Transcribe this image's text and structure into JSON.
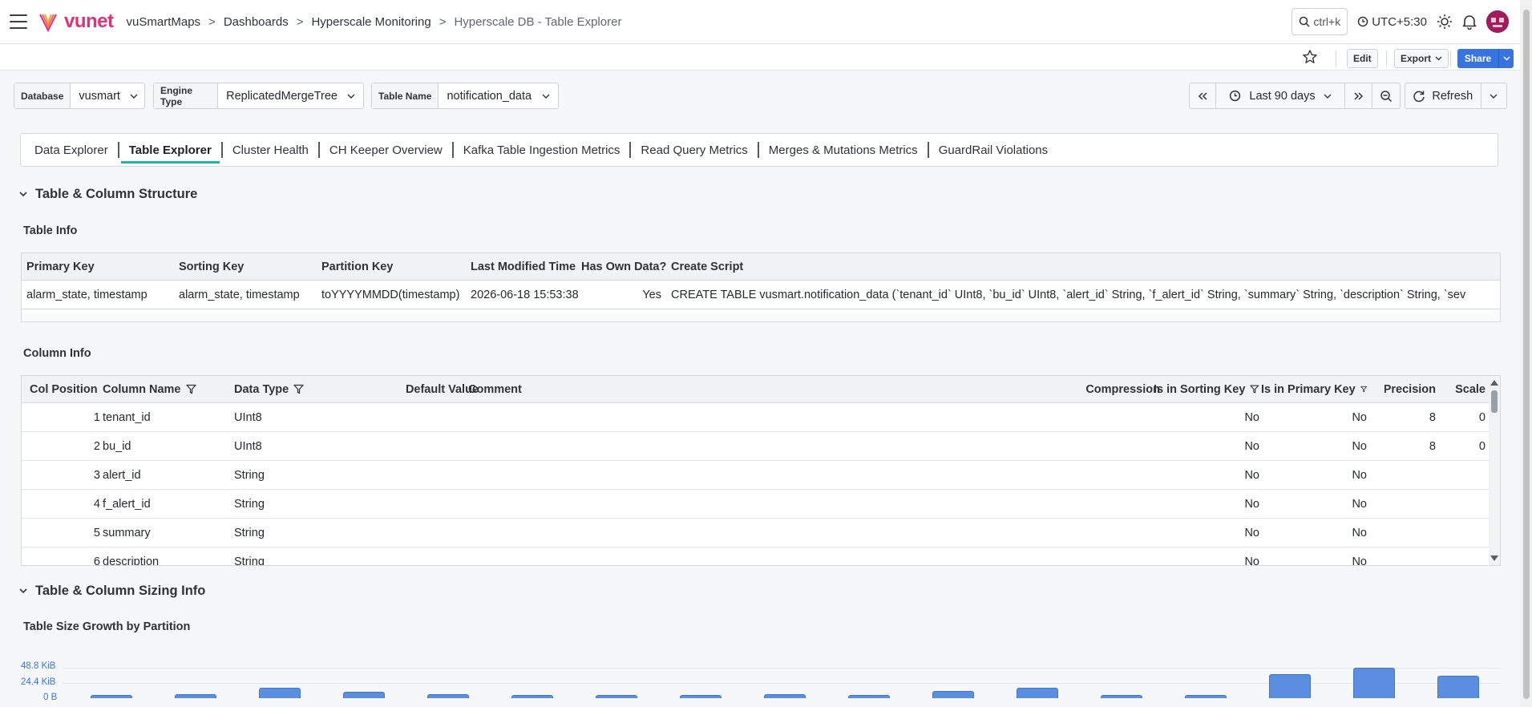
{
  "topbar": {
    "logo_text": "vunet",
    "breadcrumbs": [
      "vuSmartMaps",
      "Dashboards",
      "Hyperscale Monitoring",
      "Hyperscale DB - Table Explorer"
    ],
    "search_shortcut": "ctrl+k",
    "timezone": "UTC+5:30"
  },
  "actions": {
    "edit": "Edit",
    "export": "Export",
    "share": "Share"
  },
  "variables": [
    {
      "label": "Database",
      "value": "vusmart"
    },
    {
      "label": "Engine Type",
      "value": "ReplicatedMergeTree"
    },
    {
      "label": "Table Name",
      "value": "notification_data"
    }
  ],
  "time": {
    "range": "Last 90 days",
    "refresh": "Refresh"
  },
  "tabs": [
    "Data Explorer",
    "Table Explorer",
    "Cluster Health",
    "CH Keeper Overview",
    "Kafka Table Ingestion Metrics",
    "Read Query Metrics",
    "Merges & Mutations Metrics",
    "GuardRail Violations"
  ],
  "active_tab": "Table Explorer",
  "section1": {
    "title": "Table & Column Structure"
  },
  "table_info": {
    "title": "Table Info",
    "columns": [
      "Primary Key",
      "Sorting Key",
      "Partition Key",
      "Last Modified Time",
      "Has Own Data?",
      "Create Script"
    ],
    "row": [
      "alarm_state, timestamp",
      "alarm_state, timestamp",
      "toYYYYMMDD(timestamp)",
      "2026-06-18 15:53:38",
      "Yes",
      "CREATE TABLE vusmart.notification_data (`tenant_id` UInt8, `bu_id` UInt8, `alert_id` String, `f_alert_id` String, `summary` String, `description` String, `sev"
    ]
  },
  "column_info": {
    "title": "Column Info",
    "columns": [
      "Col Position",
      "Column Name",
      "Data Type",
      "Default Value",
      "Comment",
      "Compression",
      "Is in Sorting Key",
      "Is in Primary Key",
      "Precision",
      "Scale"
    ],
    "rows": [
      [
        "1",
        "tenant_id",
        "UInt8",
        "",
        "",
        "",
        "No",
        "No",
        "8",
        "0"
      ],
      [
        "2",
        "bu_id",
        "UInt8",
        "",
        "",
        "",
        "No",
        "No",
        "8",
        "0"
      ],
      [
        "3",
        "alert_id",
        "String",
        "",
        "",
        "",
        "No",
        "No",
        "",
        ""
      ],
      [
        "4",
        "f_alert_id",
        "String",
        "",
        "",
        "",
        "No",
        "No",
        "",
        ""
      ],
      [
        "5",
        "summary",
        "String",
        "",
        "",
        "",
        "No",
        "No",
        "",
        ""
      ],
      [
        "6",
        "description",
        "String",
        "",
        "",
        "",
        "No",
        "No",
        "",
        ""
      ]
    ]
  },
  "section2": {
    "title": "Table & Column Sizing Info"
  },
  "chart_title": "Table Size Growth by Partition",
  "chart_data": {
    "type": "bar",
    "title": "Table Size Growth by Partition",
    "y_ticks": [
      "48.8 KiB",
      "24.4 KiB",
      "0 B"
    ],
    "ylim": [
      0,
      48.8
    ],
    "y_unit": "KiB",
    "values": [
      4,
      7,
      17,
      10,
      7,
      4,
      4,
      4,
      7,
      4,
      11,
      17,
      4,
      5,
      39,
      49,
      36
    ],
    "color": "#5b8ee0"
  }
}
